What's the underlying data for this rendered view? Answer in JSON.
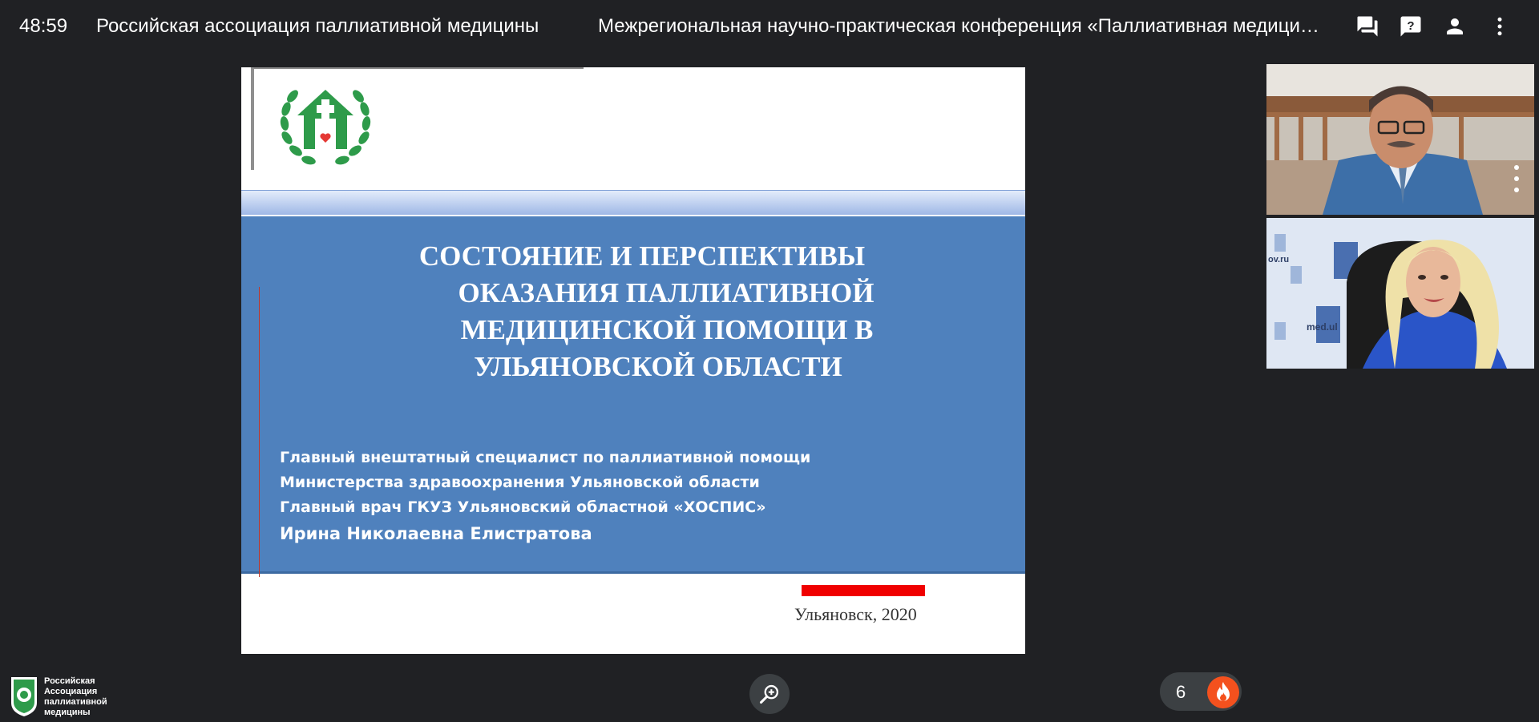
{
  "header": {
    "timer": "48:59",
    "org_title": "Российская ассоциация паллиативной медицины",
    "meeting_title": "Межрегиональная научно-практическая конференция «Паллиативная медицинская помощь: опыт регионов»",
    "icons": [
      "chat-icon",
      "help-icon",
      "person-icon",
      "more-vert-icon"
    ]
  },
  "slide": {
    "title_lines": [
      "СОСТОЯНИЕ И ПЕРСПЕКТИВЫ",
      "ОКАЗАНИЯ ПАЛЛИАТИВНОЙ",
      "МЕДИЦИНСКОЙ ПОМОЩИ В",
      "УЛЬЯНОВСКОЙ ОБЛАСТИ"
    ],
    "subtitle_lines": [
      "Главный внештатный специалист по паллиативной помощи",
      "Министерства здравоохранения Ульяновской области",
      "Главный врач ГКУЗ Ульяновский областной «ХОСПИС»"
    ],
    "speaker_name": "Ирина Николаевна Елистратова",
    "place_year": "Ульяновск, 2020",
    "colors": {
      "title_band": "#4f81bd",
      "accent_bar": "#f00000",
      "logo_green": "#2e9b4a"
    }
  },
  "participants": {
    "tile1_backdrop_text": "",
    "tile2_backdrop_text_1": "ov.ru",
    "tile2_backdrop_text_2": "med.ul"
  },
  "footer": {
    "logo_text_lines": [
      "Российская",
      "Ассоциация",
      "паллиативной",
      "медицины"
    ],
    "zoom_icon": "zoom-in-icon",
    "reaction_count": "6",
    "reaction_icon": "fire-icon"
  }
}
